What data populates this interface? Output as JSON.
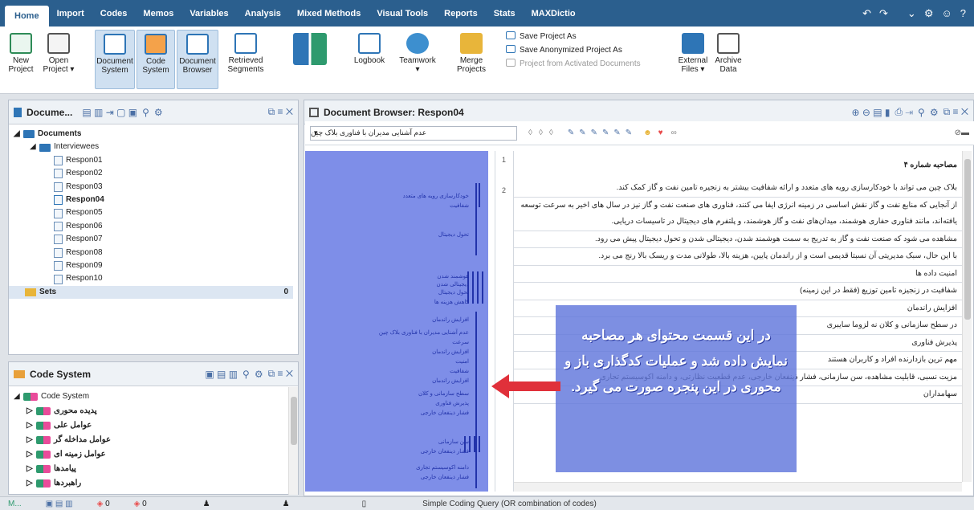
{
  "menu": {
    "items": [
      "Home",
      "Import",
      "Codes",
      "Memos",
      "Variables",
      "Analysis",
      "Mixed Methods",
      "Visual Tools",
      "Reports",
      "Stats",
      "MAXDictio"
    ],
    "right_icons": [
      "undo-icon",
      "redo-icon",
      "collapse-icon",
      "settings-icon",
      "smiley-icon",
      "help-icon"
    ]
  },
  "ribbon": {
    "new_project": "New Project",
    "open_project": "Open Project ▾",
    "document_system": "Document System",
    "code_system": "Code System",
    "document_browser": "Document Browser",
    "retrieved_segments": "Retrieved Segments",
    "logbook": "Logbook",
    "teamwork": "Teamwork ▾",
    "merge_projects": "Merge Projects",
    "save_project_as": "Save Project As",
    "save_anonymized": "Save Anonymized Project As",
    "project_from_activated": "Project from Activated Documents",
    "external_files": "External Files ▾",
    "archive_data": "Archive Data"
  },
  "documents_panel": {
    "title": "Docume...",
    "root": "Documents",
    "group": "Interviewees",
    "docs": [
      "Respon01",
      "Respon02",
      "Respon03",
      "Respon04",
      "Respon05",
      "Respon06",
      "Respon07",
      "Respon08",
      "Respon09",
      "Respon10"
    ],
    "active_doc": "Respon04",
    "sets_label": "Sets",
    "sets_count": "0"
  },
  "code_panel": {
    "title": "Code System",
    "root": "Code System",
    "codes": [
      "پدیده محوری",
      "عوامل علی",
      "عوامل مداخله گر",
      "عوامل زمینه ای",
      "پیامدها",
      "راهبردها"
    ]
  },
  "browser": {
    "title": "Document Browser: Respon04",
    "select_value": "عدم آشنایی مدیران با فناوری بلاک چین",
    "line_numbers": [
      "1",
      "2"
    ],
    "heading": "مصاحبه شماره ۴",
    "paragraphs": [
      "بلاک چین می تواند با خودکارسازی رویه های متعدد و ارائه شفافیت بیشتر به زنجیره تامین نفت و گاز کمک کند.",
      "از آنجایی که منابع نفت و گاز نقش اساسی در زمینه انرژی ایفا می کنند، فناوری های صنعت نفت و گاز نیز در سال های اخیر به سرعت توسعه یافته‌اند، مانند فناوری حفاری هوشمند، میدان‌های نفت و گاز هوشمند، و پلتفرم های دیجیتال در تاسیسات دریایی.",
      "مشاهده می شود که صنعت نفت و گاز به تدریج به سمت هوشمند شدن، دیجیتالی شدن و تحول دیجیتال  پیش می رود.",
      "با این حال، سبک مدیریتی آن نسبتا قدیمی است و از راندمان پایین، هزینه بالا، طولانی مدت و ریسک بالا رنج می برد.",
      "امنیت داده ها",
      "شفافیت در زنجیزه تامین توزیع (فقط در این زمینه)",
      "افزایش راندمان",
      "در سطح سازمانی و کلان نه لزوما سایبری",
      "پذیرش فناوری",
      "مهم ترین بازدارنده افراد و کاربران هستند",
      "مزیت نسبی، قابلیت مشاهده، سن سازمانی، فشار ذینفعان خارجی، عدم قطعیت نظارتی، و دامنه اکوسیستم تجاری",
      "سهامداران"
    ],
    "coded_labels": [
      "خودکارسازی رویه های متعدد",
      "شفافیت",
      "تحول دیجیتال",
      "هوشمند شدن",
      "دیجیتالی شدن",
      "تحول دیجیتال",
      "کاهش هزینه ها",
      "افزایش راندمان",
      "عدم آشنایی مدیران با فناوری بلاک چین",
      "سرعت",
      "افزایش راندمان",
      "امنیت",
      "شفافیت",
      "افزایش راندمان",
      "سطح سازمانی و کلان",
      "پذیرش فناوری",
      "فشار ذینفعان خارجی",
      "سن سازمانی",
      "فشار ذینفعان خارجی",
      "دامنه اکوسیستم تجاری",
      "فشار ذینفعان خارجی"
    ],
    "overlay_text": "در این قسمت محتوای هر مصاحبه نمایش داده شد و عملیات کدگذاری باز و محوری در این پنجره صورت می گیرد."
  },
  "status": {
    "left": "M...",
    "count1": "0",
    "count2": "0",
    "query": "Simple Coding Query (OR combination of codes)"
  },
  "colors": {
    "menubar": "#2b5f8e",
    "codebar": "#7e8ee8",
    "overlay": "#6076dc",
    "arrow": "#e0303a"
  }
}
